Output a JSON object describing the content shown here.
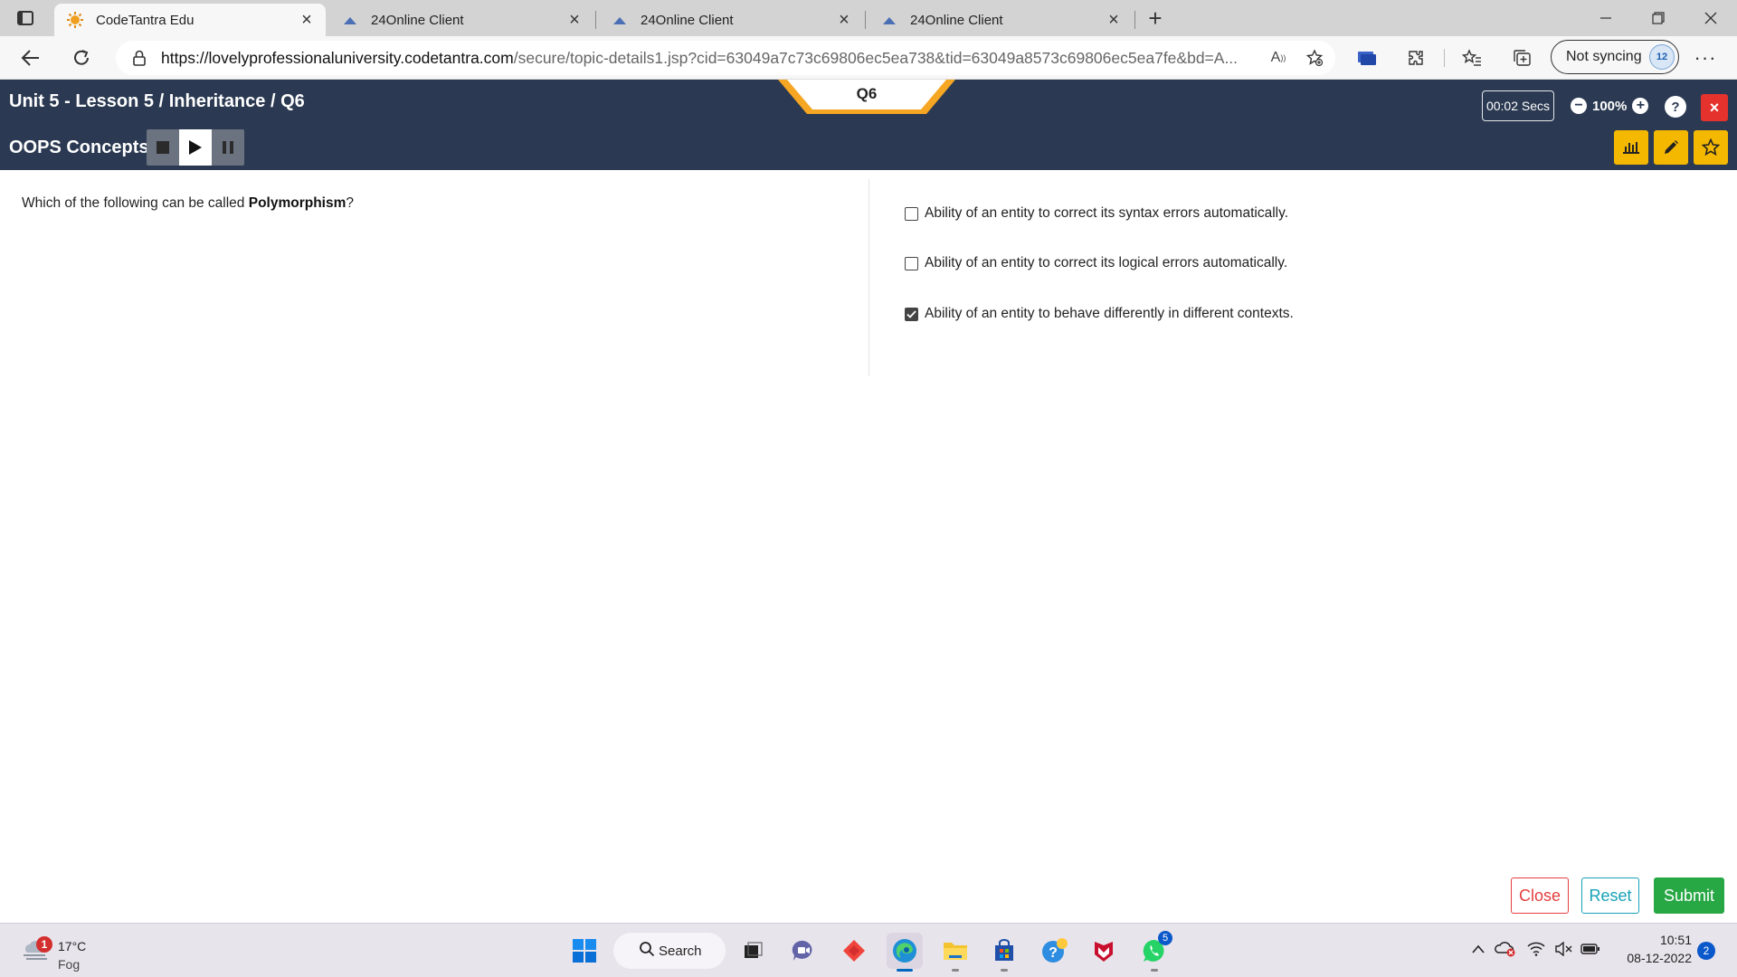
{
  "browser": {
    "tabs": [
      {
        "title": "CodeTantra Edu",
        "active": true
      },
      {
        "title": "24Online Client",
        "active": false
      },
      {
        "title": "24Online Client",
        "active": false
      },
      {
        "title": "24Online Client",
        "active": false
      }
    ],
    "url_host": "https://lovelyprofessionaluniversity.codetantra.com",
    "url_path": "/secure/topic-details1.jsp?cid=63049a7c73c69806ec5ea738&tid=63049a8573c69806ec5ea7fe&bd=A...",
    "sync_label": "Not syncing"
  },
  "header": {
    "breadcrumb": "Unit 5 - Lesson 5 / Inheritance / Q6",
    "topic": "OOPS Concepts",
    "question_tab": "Q6",
    "timer": "00:02 Secs",
    "zoom": "100%",
    "help": "?",
    "close": "×"
  },
  "question": {
    "prefix": "Which of the following can be called ",
    "highlight": "Polymorphism",
    "suffix": "?"
  },
  "options": [
    {
      "text": "Ability of an entity to correct its syntax errors automatically.",
      "checked": false
    },
    {
      "text": "Ability of an entity to correct its logical errors automatically.",
      "checked": false
    },
    {
      "text": "Ability of an entity to behave differently in different contexts.",
      "checked": true
    }
  ],
  "actions": {
    "close": "Close",
    "reset": "Reset",
    "submit": "Submit"
  },
  "taskbar": {
    "weather_temp": "17°C",
    "weather_cond": "Fog",
    "weather_badge": "1",
    "search_label": "Search",
    "whatsapp_badge": "5",
    "time": "10:51",
    "date": "08-12-2022",
    "notifications": "2"
  },
  "colors": {
    "header_bg": "#2b3a52",
    "accent_orange": "#f5a623",
    "toolbar_yellow": "#f5b800",
    "close_red": "#e53e3e",
    "reset_teal": "#17a2b8",
    "submit_green": "#28a745"
  }
}
